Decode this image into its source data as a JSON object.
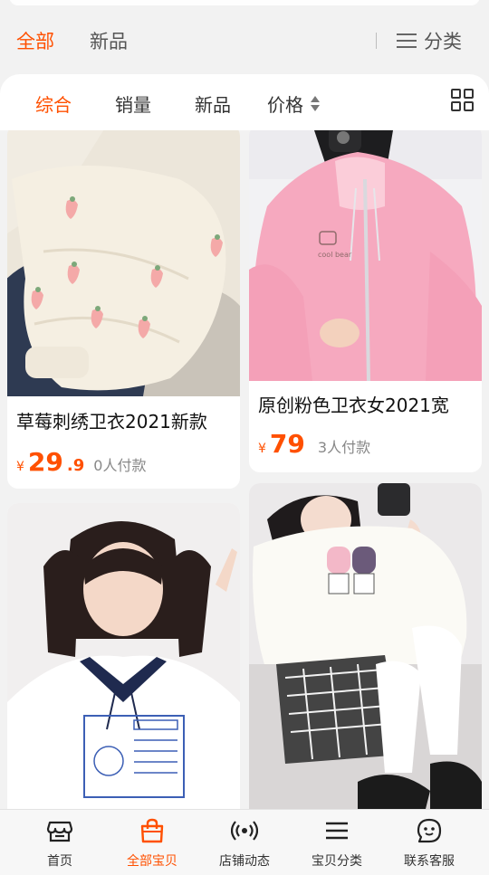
{
  "top_tabs": {
    "all": "全部",
    "new": "新品",
    "category": "分类"
  },
  "sort_bar": {
    "comprehensive": "综合",
    "sales": "销量",
    "new": "新品",
    "price": "价格"
  },
  "products": [
    {
      "title": "草莓刺绣卫衣2021新款",
      "currency": "¥",
      "price_int": "29",
      "price_dec": ".9",
      "paid": "0人付款"
    },
    {
      "title": "原创粉色卫衣女2021宽",
      "currency": "¥",
      "price_int": "79",
      "price_dec": "",
      "paid": "3人付款"
    }
  ],
  "bottom_nav": [
    {
      "label": "首页",
      "icon": "shop-icon"
    },
    {
      "label": "全部宝贝",
      "icon": "bag-icon",
      "active": true
    },
    {
      "label": "店铺动态",
      "icon": "broadcast-icon"
    },
    {
      "label": "宝贝分类",
      "icon": "list-icon"
    },
    {
      "label": "联系客服",
      "icon": "chat-face-icon"
    }
  ],
  "colors": {
    "accent": "#ff5000",
    "background": "#f2f2f2",
    "text": "#333333"
  }
}
